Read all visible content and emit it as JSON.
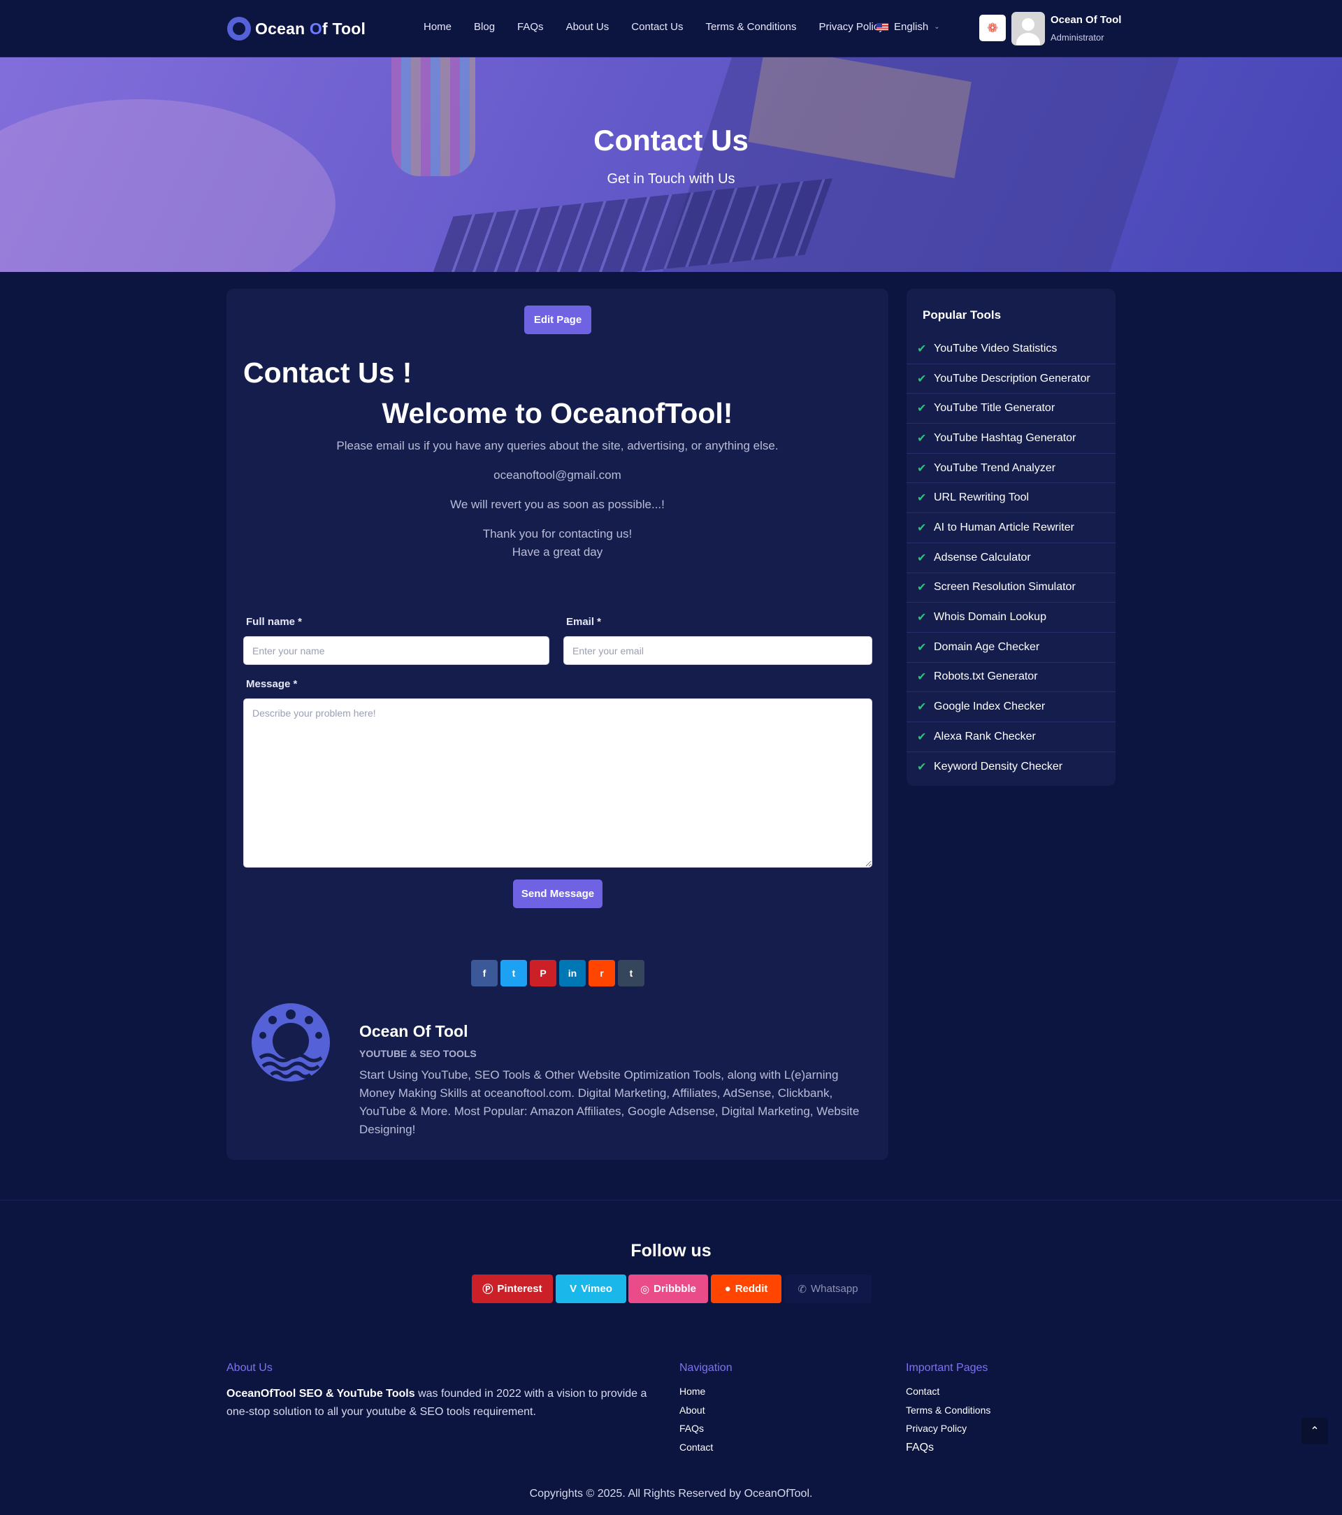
{
  "header": {
    "logo_prefix": "Ocean ",
    "logo_o": "O",
    "logo_suffix": "f Tool",
    "nav": [
      "Home",
      "Blog",
      "FAQs",
      "About Us",
      "Contact Us",
      "Terms & Conditions",
      "Privacy Policy"
    ],
    "language": "English",
    "user_name": "Ocean Of Tool",
    "user_role": "Administrator"
  },
  "hero": {
    "title": "Contact Us",
    "subtitle": "Get in Touch with Us"
  },
  "main": {
    "edit_label": "Edit Page",
    "heading": "Contact Us !",
    "welcome": "Welcome to OceanofTool!",
    "intro": "Please email us if you have any queries about the site, advertising, or anything else.",
    "email": "oceanoftool@gmail.com",
    "revert": "We will revert you as soon as possible...!",
    "thanks": "Thank you for contacting us!",
    "greeting": "Have a great day",
    "form": {
      "name_label": "Full name *",
      "name_placeholder": "Enter your name",
      "email_label": "Email *",
      "email_placeholder": "Enter your email",
      "message_label": "Message *",
      "message_placeholder": "Describe your problem here!",
      "send_label": "Send Message"
    },
    "share_icons": [
      {
        "name": "facebook-icon",
        "glyph": "f",
        "color": "#3b5998"
      },
      {
        "name": "twitter-icon",
        "glyph": "t",
        "color": "#1da1f2"
      },
      {
        "name": "pinterest-icon",
        "glyph": "P",
        "color": "#cb2027"
      },
      {
        "name": "linkedin-icon",
        "glyph": "in",
        "color": "#0077b5"
      },
      {
        "name": "reddit-icon",
        "glyph": "r",
        "color": "#ff4500"
      },
      {
        "name": "tumblr-icon",
        "glyph": "t",
        "color": "#35465c"
      }
    ],
    "author": {
      "name": "Ocean Of Tool",
      "tag": "YOUTUBE & SEO TOOLS",
      "bio": "Start Using YouTube, SEO Tools & Other Website Optimization Tools, along with L(e)arning Money Making Skills at oceanoftool.com. Digital Marketing, Affiliates, AdSense, Clickbank, YouTube & More. Most Popular: Amazon Affiliates, Google Adsense, Digital Marketing, Website Designing!"
    }
  },
  "sidebar": {
    "title": "Popular Tools",
    "tools": [
      "YouTube Video Statistics",
      "YouTube Description Generator",
      "YouTube Title Generator",
      "YouTube Hashtag Generator",
      "YouTube Trend Analyzer",
      "URL Rewriting Tool",
      "AI to Human Article Rewriter",
      "Adsense Calculator",
      "Screen Resolution Simulator",
      "Whois Domain Lookup",
      "Domain Age Checker",
      "Robots.txt Generator",
      "Google Index Checker",
      "Alexa Rank Checker",
      "Keyword Density Checker"
    ]
  },
  "follow": {
    "title": "Follow us",
    "buttons": [
      {
        "label": "Pinterest",
        "color": "#cb2027"
      },
      {
        "label": "Vimeo",
        "color": "#1ab7ea"
      },
      {
        "label": "Dribbble",
        "color": "#ea4c89"
      },
      {
        "label": "Reddit",
        "color": "#ff4500"
      },
      {
        "label": "Whatsapp",
        "color": "#0f1848"
      }
    ]
  },
  "footer": {
    "about_title": "About Us",
    "about_brand": "OceanOfTool SEO & YouTube Tools",
    "about_text": " was founded in 2022 with a vision to provide a one-stop solution to all your youtube & SEO tools requirement.",
    "nav_title": "Navigation",
    "nav_links": [
      "Home",
      "About",
      "FAQs",
      "Contact"
    ],
    "pages_title": "Important Pages",
    "pages_links": [
      "Contact",
      "Terms & Conditions",
      "Privacy Policy",
      "FAQs"
    ],
    "copyright": "Copyrights © 2025. All Rights Reserved by OceanOfTool."
  },
  "colors": {
    "background": "#0c1440",
    "card": "#141d4c",
    "accent": "#6f63e3",
    "check": "#2fc07b",
    "footer_heading": "#7f73f0"
  }
}
